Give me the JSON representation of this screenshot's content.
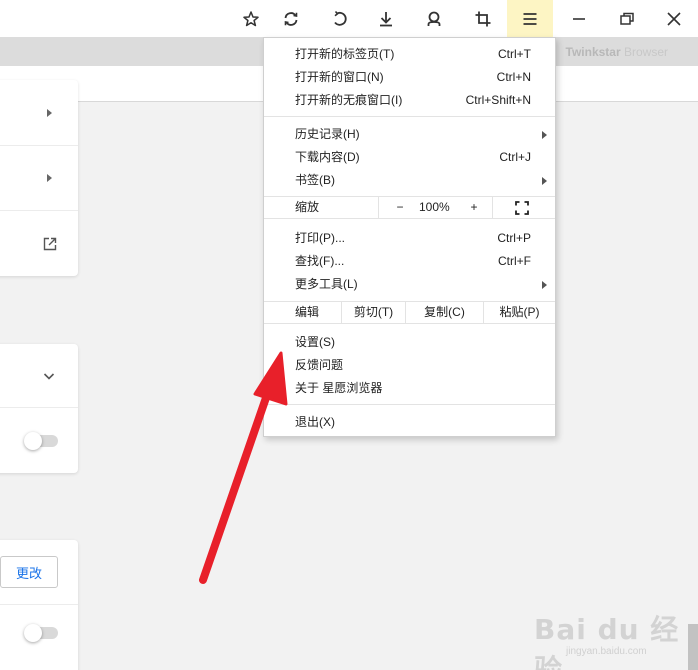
{
  "brand": {
    "bold": "Twinkstar",
    "light": "Browser"
  },
  "toolbar_icons": [
    "star-icon",
    "sync-icon",
    "undo-icon",
    "download-icon",
    "user-icon",
    "crop-icon",
    "menu-icon",
    "minimize-icon",
    "restore-icon",
    "close-icon"
  ],
  "settings": {
    "change_label": "更改"
  },
  "menu": {
    "group1": [
      {
        "label": "打开新的标签页(T)",
        "shortcut": "Ctrl+T"
      },
      {
        "label": "打开新的窗口(N)",
        "shortcut": "Ctrl+N"
      },
      {
        "label": "打开新的无痕窗口(I)",
        "shortcut": "Ctrl+Shift+N"
      }
    ],
    "group2": [
      {
        "label": "历史记录(H)"
      },
      {
        "label": "下载内容(D)",
        "shortcut": "Ctrl+J"
      },
      {
        "label": "书签(B)"
      }
    ],
    "zoom": {
      "label": "缩放",
      "minus": "−",
      "value": "100%",
      "plus": "+"
    },
    "group3": [
      {
        "label": "打印(P)...",
        "shortcut": "Ctrl+P"
      },
      {
        "label": "查找(F)...",
        "shortcut": "Ctrl+F"
      },
      {
        "label": "更多工具(L)"
      }
    ],
    "edit": {
      "label": "编辑",
      "cut": "剪切(T)",
      "copy": "复制(C)",
      "paste": "粘贴(P)"
    },
    "group4": [
      {
        "label": "设置(S)"
      },
      {
        "label": "反馈问题"
      },
      {
        "label": "关于 星愿浏览器"
      }
    ],
    "exit": {
      "label": "退出(X)"
    }
  },
  "watermark": {
    "text": "Bai du 经验",
    "sub": "jingyan.baidu.com"
  },
  "colors": {
    "menu_active_bg": "#fdf5c4",
    "arrow": "#e8202a",
    "link": "#1a73e8"
  }
}
